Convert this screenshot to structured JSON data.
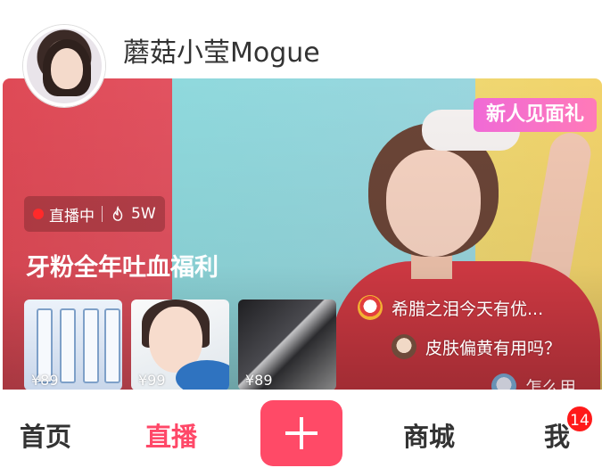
{
  "header": {
    "user_name": "蘑菇小莹Mogue"
  },
  "live_card": {
    "gift_badge": "新人见面礼",
    "status": {
      "label": "直播中",
      "viewers": "5W"
    },
    "title": "牙粉全年吐血福利",
    "products": [
      {
        "price": "¥89"
      },
      {
        "price": "¥99"
      },
      {
        "price": "¥89"
      }
    ],
    "comments": [
      {
        "text": "希腊之泪今天有优..."
      },
      {
        "text": "皮肤偏黄有用吗？"
      },
      {
        "text": "怎么用"
      }
    ],
    "colors": {
      "left_panel": "#e25260",
      "middle_panel": "#9ad6de",
      "right_panel": "#f2d36b"
    }
  },
  "bottom_nav": {
    "home": "首页",
    "live": "直播",
    "add_icon": "plus-icon",
    "mall": "商城",
    "me": "我",
    "me_badge": "14",
    "active_color": "#ff4868"
  }
}
